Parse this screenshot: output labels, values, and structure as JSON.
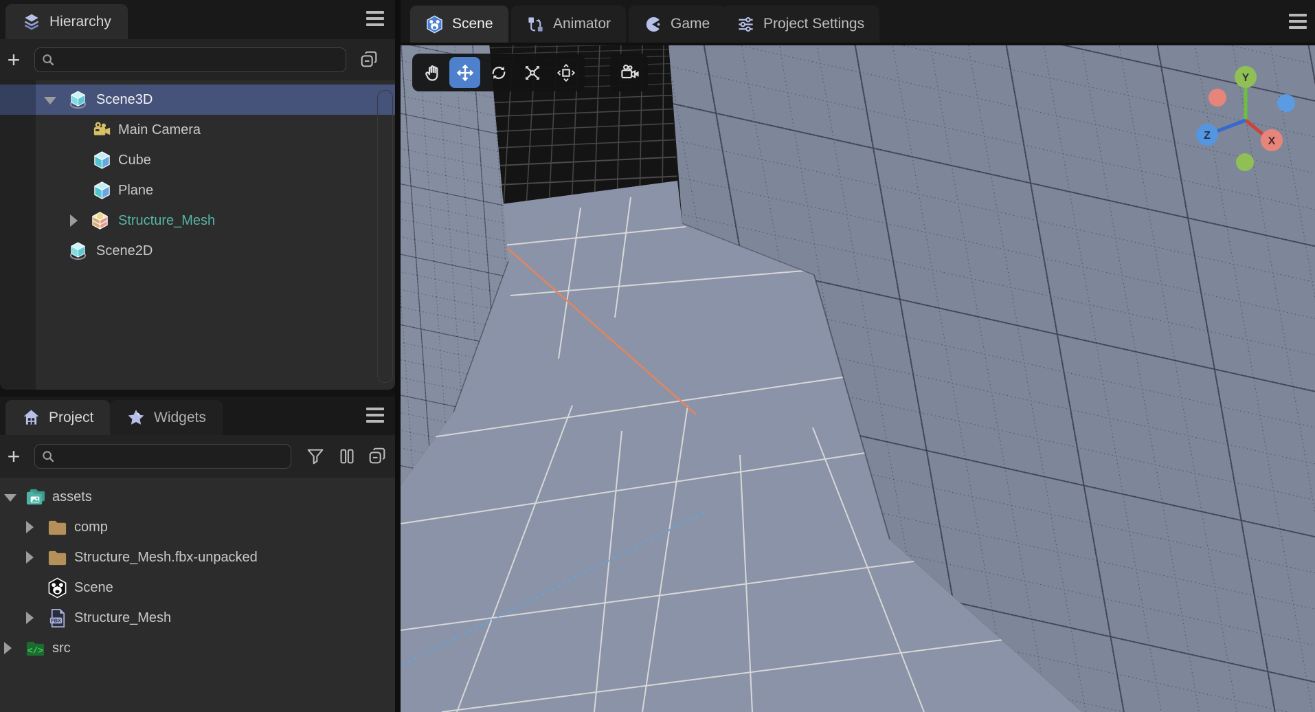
{
  "hierarchy": {
    "tab_label": "Hierarchy",
    "tab_icon": "layers-icon",
    "search": {
      "placeholder": "",
      "value": "",
      "icon": "search-icon"
    },
    "toolbar_icons": [
      "plus-icon",
      "collapse-all-icon",
      "menu-icon"
    ],
    "items": [
      {
        "label": "Scene3D",
        "icon": "scene-cube-icon",
        "expanded": true,
        "selected": true
      },
      {
        "label": "Main Camera",
        "icon": "camera-icon"
      },
      {
        "label": "Cube",
        "icon": "cube-icon"
      },
      {
        "label": "Plane",
        "icon": "cube-icon"
      },
      {
        "label": "Structure_Mesh",
        "icon": "prefab-cube-icon",
        "collapsed": true,
        "text_color": "#56b5a5"
      },
      {
        "label": "Scene2D",
        "icon": "scene-cube-icon"
      }
    ]
  },
  "project": {
    "tabs": [
      {
        "label": "Project",
        "icon": "house-icon",
        "active": true
      },
      {
        "label": "Widgets",
        "icon": "star-icon",
        "active": false
      }
    ],
    "search": {
      "placeholder": "",
      "value": "",
      "icon": "search-icon"
    },
    "toolbar_icons": [
      "plus-icon",
      "filter-icon",
      "columns-icon",
      "collapse-all-icon",
      "menu-icon"
    ],
    "items": [
      {
        "label": "assets",
        "icon": "assets-folder-icon",
        "expanded": true
      },
      {
        "label": "comp",
        "icon": "folder-icon",
        "collapsed": true
      },
      {
        "label": "Structure_Mesh.fbx-unpacked",
        "icon": "folder-icon",
        "collapsed": true
      },
      {
        "label": "Scene",
        "icon": "scene-hex-icon"
      },
      {
        "label": "Structure_Mesh",
        "icon": "fbx-file-icon",
        "collapsed": true
      },
      {
        "label": "src",
        "icon": "src-folder-icon",
        "collapsed": true
      }
    ]
  },
  "viewport": {
    "tabs": [
      {
        "label": "Scene",
        "icon": "scene-hex-icon",
        "active": true
      },
      {
        "label": "Animator",
        "icon": "animator-icon",
        "active": false
      },
      {
        "label": "Game",
        "icon": "game-icon",
        "active": false
      },
      {
        "label": "Project Settings",
        "icon": "sliders-icon",
        "active": false
      }
    ],
    "menu_icon": "menu-icon",
    "toolbar": {
      "tools": [
        "pan-hand",
        "move",
        "rotate",
        "scale",
        "rect-transform"
      ],
      "active_tool": "move",
      "extra": [
        "gizmo-camera"
      ]
    },
    "gizmo": {
      "x": "X",
      "y": "Y",
      "z": "Z"
    }
  },
  "colors": {
    "accent_blue": "#4e80cc",
    "selection_blue": "#45537a",
    "prefab_teal": "#56b5a5",
    "axis_x_red": "#cc4438",
    "axis_y_green": "#6cbf3f",
    "axis_z_blue": "#3668cf",
    "ball_x": "#e8857b",
    "ball_y": "#8fbf55",
    "ball_z": "#5596e0",
    "floor_gray_blue": "#8a93a8",
    "wall_gray_blue": "#7e8799",
    "x_grid_line_orange": "#e2855e",
    "z_grid_line_cyan": "#57a9e8"
  }
}
